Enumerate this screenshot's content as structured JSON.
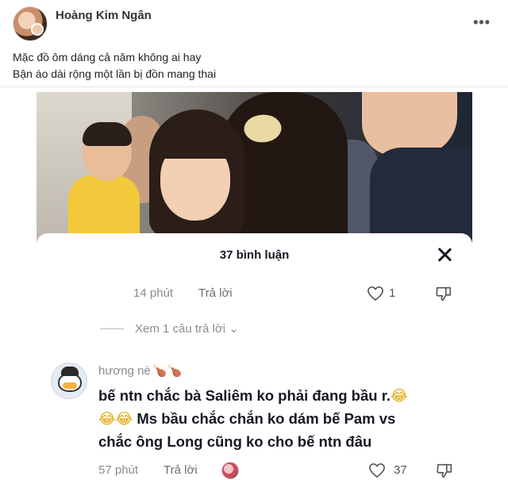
{
  "post": {
    "author": "Hoàng Kim Ngân",
    "more_label": "•••",
    "caption": [
      "Mặc đồ ôm dáng cả năm không ai hay",
      "Bận áo dài rộng một lần bị đồn mang thai"
    ]
  },
  "sheet": {
    "title": "37 bình luận",
    "prev_comment": {
      "time": "14 phút",
      "reply": "Trả lời",
      "likes": "1"
    },
    "view_replies": "Xem 1 câu trả lời ⌄",
    "comment": {
      "username": "hương nè",
      "username_emoji": "🍗🍗",
      "lines": [
        "bế ntn chắc bà Saliêm ko phải đang bầu r.",
        "Ms bầu chắc chắn ko dám bế Pam vs",
        "chắc ông Long cũng ko cho bế ntn đâu"
      ],
      "laugh_emoji": "😂",
      "time": "57 phút",
      "reply": "Trả lời",
      "likes": "37"
    }
  },
  "colors": {
    "text_primary": "#161823",
    "text_muted": "#8a8b91"
  }
}
